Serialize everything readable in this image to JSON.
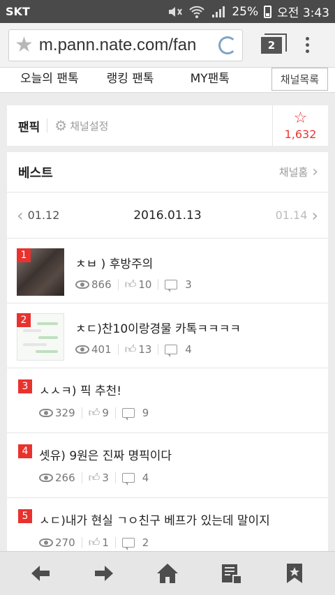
{
  "status_bar": {
    "carrier": "SKT",
    "battery": "25%",
    "time": "오전 3:43"
  },
  "browser": {
    "url": "m.pann.nate.com/fan",
    "tab_count": "2"
  },
  "nav": {
    "tabs": [
      "오늘의 팬톡",
      "랭킹 팬톡",
      "MY팬톡"
    ],
    "channel_list": "채널목록"
  },
  "channel": {
    "title": "팬픽",
    "settings": "채널설정",
    "favorites": "1,632"
  },
  "best": {
    "title": "베스트",
    "home_link": "채널홈",
    "prev_date": "01.12",
    "current_date": "2016.01.13",
    "next_date": "01.14"
  },
  "posts": [
    {
      "rank": "1",
      "title": "ㅊㅂ ) 후방주의",
      "views": "866",
      "likes": "10",
      "comments": "3"
    },
    {
      "rank": "2",
      "title": "ㅊㄷ)찬10이랑경물 카톡ㅋㅋㅋㅋ",
      "views": "401",
      "likes": "13",
      "comments": "4"
    },
    {
      "rank": "3",
      "title": "ㅅㅅㅋ) 픽 추천!",
      "views": "329",
      "likes": "9",
      "comments": "9"
    },
    {
      "rank": "4",
      "title": "셋유) 9원은 진짜 명픽이다",
      "views": "266",
      "likes": "3",
      "comments": "4"
    },
    {
      "rank": "5",
      "title": "ㅅㄷ)내가 현실 ㄱㅇ친구 베프가 있는데 말이지",
      "views": "270",
      "likes": "1",
      "comments": "2"
    }
  ],
  "colors": {
    "accent_red": "#e8322e",
    "status_bar": "#4a4a4a"
  }
}
